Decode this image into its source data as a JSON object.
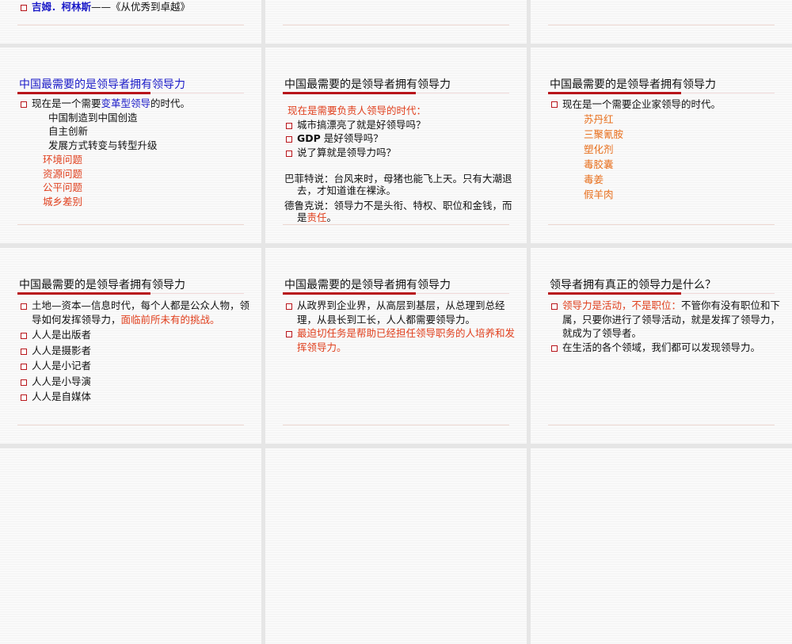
{
  "slides": [
    {
      "partial": true,
      "bullet_name": "吉姆．柯林斯",
      "bullet_rest": "——《从优秀到卓越》"
    },
    {
      "partial": true
    },
    {
      "partial": true
    },
    {
      "title": "中国最需要的是领导者拥有领导力",
      "l1a": "现在是一个需要",
      "l1b": "变革型领导",
      "l1c": "的时代。",
      "subs": [
        "中国制造到中国创造",
        "自主创新",
        "发展方式转变与转型升级"
      ],
      "reds": [
        "环境问题",
        "资源问题",
        "公平问题",
        "城乡差别"
      ]
    },
    {
      "title": "中国最需要的是领导者拥有领导力",
      "head": "现在是需要负责人领导的时代：",
      "q1": "城市搞漂亮了就是好领导吗？",
      "q2a": "GDP",
      "q2b": " 是好领导吗？",
      "q3": "说了算就是领导力吗？",
      "quote1": "巴菲特说：台风来时，母猪也能飞上天。只有大潮退去，才知道谁在裸泳。",
      "quote2a": "德鲁克说：领导力不是头衔、特权、职位和金钱，而是",
      "quote2b": "责任",
      "quote2c": "。"
    },
    {
      "title": "中国最需要的是领导者拥有领导力",
      "l1": "现在是一个需要企业家领导的时代。",
      "items": [
        "苏丹红",
        "三聚氰胺",
        "塑化剂",
        "毒胶囊",
        "毒姜",
        "假羊肉"
      ]
    },
    {
      "title": "中国最需要的是领导者拥有领导力",
      "l1a": "土地—资本—信息时代，每个人都是公众人物，领导如何发挥领导力，",
      "l1b": "面临前所未有的挑战。",
      "items": [
        "人人是出版者",
        "人人是摄影者",
        "人人是小记者",
        "人人是小导演",
        "人人是自媒体"
      ]
    },
    {
      "title": "中国最需要的是领导者拥有领导力",
      "l1": "从政界到企业界，从高层到基层，从总理到总经理，从县长到工长，人人都需要领导力。",
      "l2": "最迫切任务是帮助已经担任领导职务的人培养和发挥领导力。"
    },
    {
      "title": "领导者拥有真正的领导力是什么？",
      "l1a": "领导力是活动，不是职位：",
      "l1b": "不管你有没有职位和下属，只要你进行了领导活动，就是发挥了领导力，就成为了领导者。",
      "l2": "在生活的各个领域，我们都可以发现领导力。"
    }
  ]
}
